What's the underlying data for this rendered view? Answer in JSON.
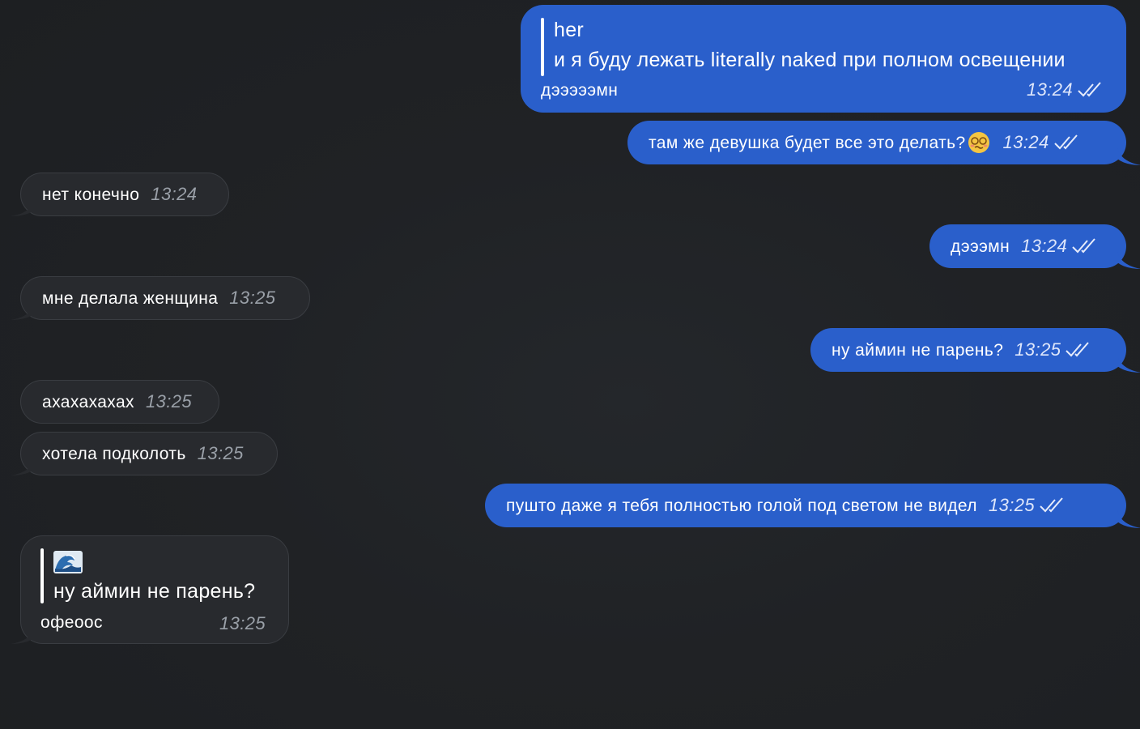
{
  "colors": {
    "outgoing_bubble": "#2a5fcb",
    "incoming_bubble": "#282a2e",
    "background": "#1f2124"
  },
  "messages": [
    {
      "direction": "outgoing",
      "reply_author": "her",
      "reply_text": "и я буду лежать literally naked при полном освещении",
      "text": "дэээээмн",
      "time": "13:24",
      "status": "read"
    },
    {
      "direction": "outgoing",
      "text": "там же девушка будет все это делать?",
      "emoji": "woozy-face-emoji",
      "time": "13:24",
      "status": "read"
    },
    {
      "direction": "incoming",
      "text": "нет конечно",
      "time": "13:24"
    },
    {
      "direction": "outgoing",
      "text": "дэээмн",
      "time": "13:24",
      "status": "read"
    },
    {
      "direction": "incoming",
      "text": "мне делала женщина",
      "time": "13:25"
    },
    {
      "direction": "outgoing",
      "text": "ну аймин не парень?",
      "time": "13:25",
      "status": "read"
    },
    {
      "direction": "incoming",
      "text": "ахахахахах",
      "time": "13:25"
    },
    {
      "direction": "incoming",
      "text": "хотела подколоть",
      "time": "13:25"
    },
    {
      "direction": "outgoing",
      "text": "пушто даже я тебя полностью голой под светом не видел",
      "time": "13:25",
      "status": "read"
    },
    {
      "direction": "incoming",
      "reply_author_icon": "wave-emoji",
      "reply_text": "ну аймин не парень?",
      "text": "офеоос",
      "time": "13:25"
    }
  ]
}
